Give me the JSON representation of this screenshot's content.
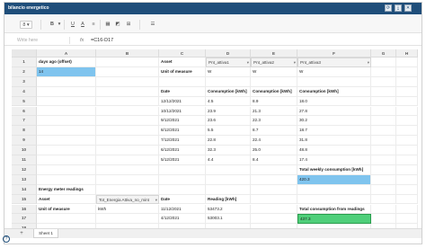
{
  "window": {
    "title": "bilancio energetico"
  },
  "window_buttons": [
    "refresh-icon",
    "export-icon",
    "close-icon"
  ],
  "toolbar": {
    "zoom_value": "8",
    "bold_label": "B",
    "underline_label": "U",
    "font_color_label": "A",
    "align_label": "≡",
    "items": [
      "zoom-select",
      "bold-icon",
      "underline-icon",
      "font-color-icon",
      "align-left-icon",
      "border-icon",
      "fill-icon",
      "merge-icon",
      "format-icon"
    ]
  },
  "formula_bar": {
    "name_box_placeholder": "Write here",
    "fx_label": "fx",
    "formula": "=C16-D17"
  },
  "grid": {
    "columns": [
      "A",
      "B",
      "C",
      "D",
      "E",
      "F",
      "G",
      "H"
    ],
    "rows": [
      "1",
      "2",
      "3",
      "4",
      "5",
      "6",
      "7",
      "8",
      "9",
      "10",
      "11",
      "12",
      "13",
      "14",
      "15",
      "16",
      "17",
      "18"
    ],
    "cells": {
      "A1": "days ago (offset)",
      "A2": "14",
      "C1": "Asset",
      "D1": "Pnt_attiva1",
      "E1": "Pnt_attiva2",
      "F1": "Pnt_attiva3",
      "C2": "Unit of measure",
      "D2": "W",
      "E2": "W",
      "F2": "W",
      "C4": "Date",
      "D4": "Consumption [kWh]",
      "E4": "Consumption [kWh]",
      "F4": "Consumption [kWh]",
      "C5": "12/12/2021",
      "D5": "4.5",
      "E5": "8.9",
      "F5": "18.0",
      "C6": "10/12/2021",
      "D6": "23.9",
      "E6": "21.3",
      "F6": "27.8",
      "C7": "9/12/2021",
      "D7": "23.6",
      "E7": "22.3",
      "F7": "30.2",
      "C8": "8/12/2021",
      "D8": "5.5",
      "E8": "8.7",
      "F8": "18.7",
      "C9": "7/12/2021",
      "D9": "22.8",
      "E9": "22.4",
      "F9": "31.8",
      "C10": "6/12/2021",
      "D10": "32.3",
      "E10": "25.0",
      "F10": "48.8",
      "C11": "5/12/2021",
      "D11": "4.4",
      "E11": "8.4",
      "F11": "17.4",
      "F12": "Total weekly consumption [kWh]",
      "F13": "420.3",
      "A14": "Energy meter readings",
      "A15": "Asset",
      "B15": "Tot_Energia Attiva_no_mint",
      "C15": "Date",
      "D15": "Reading [kWh]",
      "A16": "Unit of measure",
      "B16": "kWh",
      "C16": "11/12/2021",
      "D16": "53473.2",
      "F16": "Total consumption from readings",
      "C17": "4/12/2021",
      "D17": "53003.1",
      "F17": "437.3"
    }
  },
  "sheets": {
    "add_label": "+",
    "active": "Sheet 1"
  },
  "colors": {
    "title_bar": "#1f4e7a",
    "highlight_blue": "#7fc4ee",
    "highlight_green": "#4fcf7a"
  }
}
